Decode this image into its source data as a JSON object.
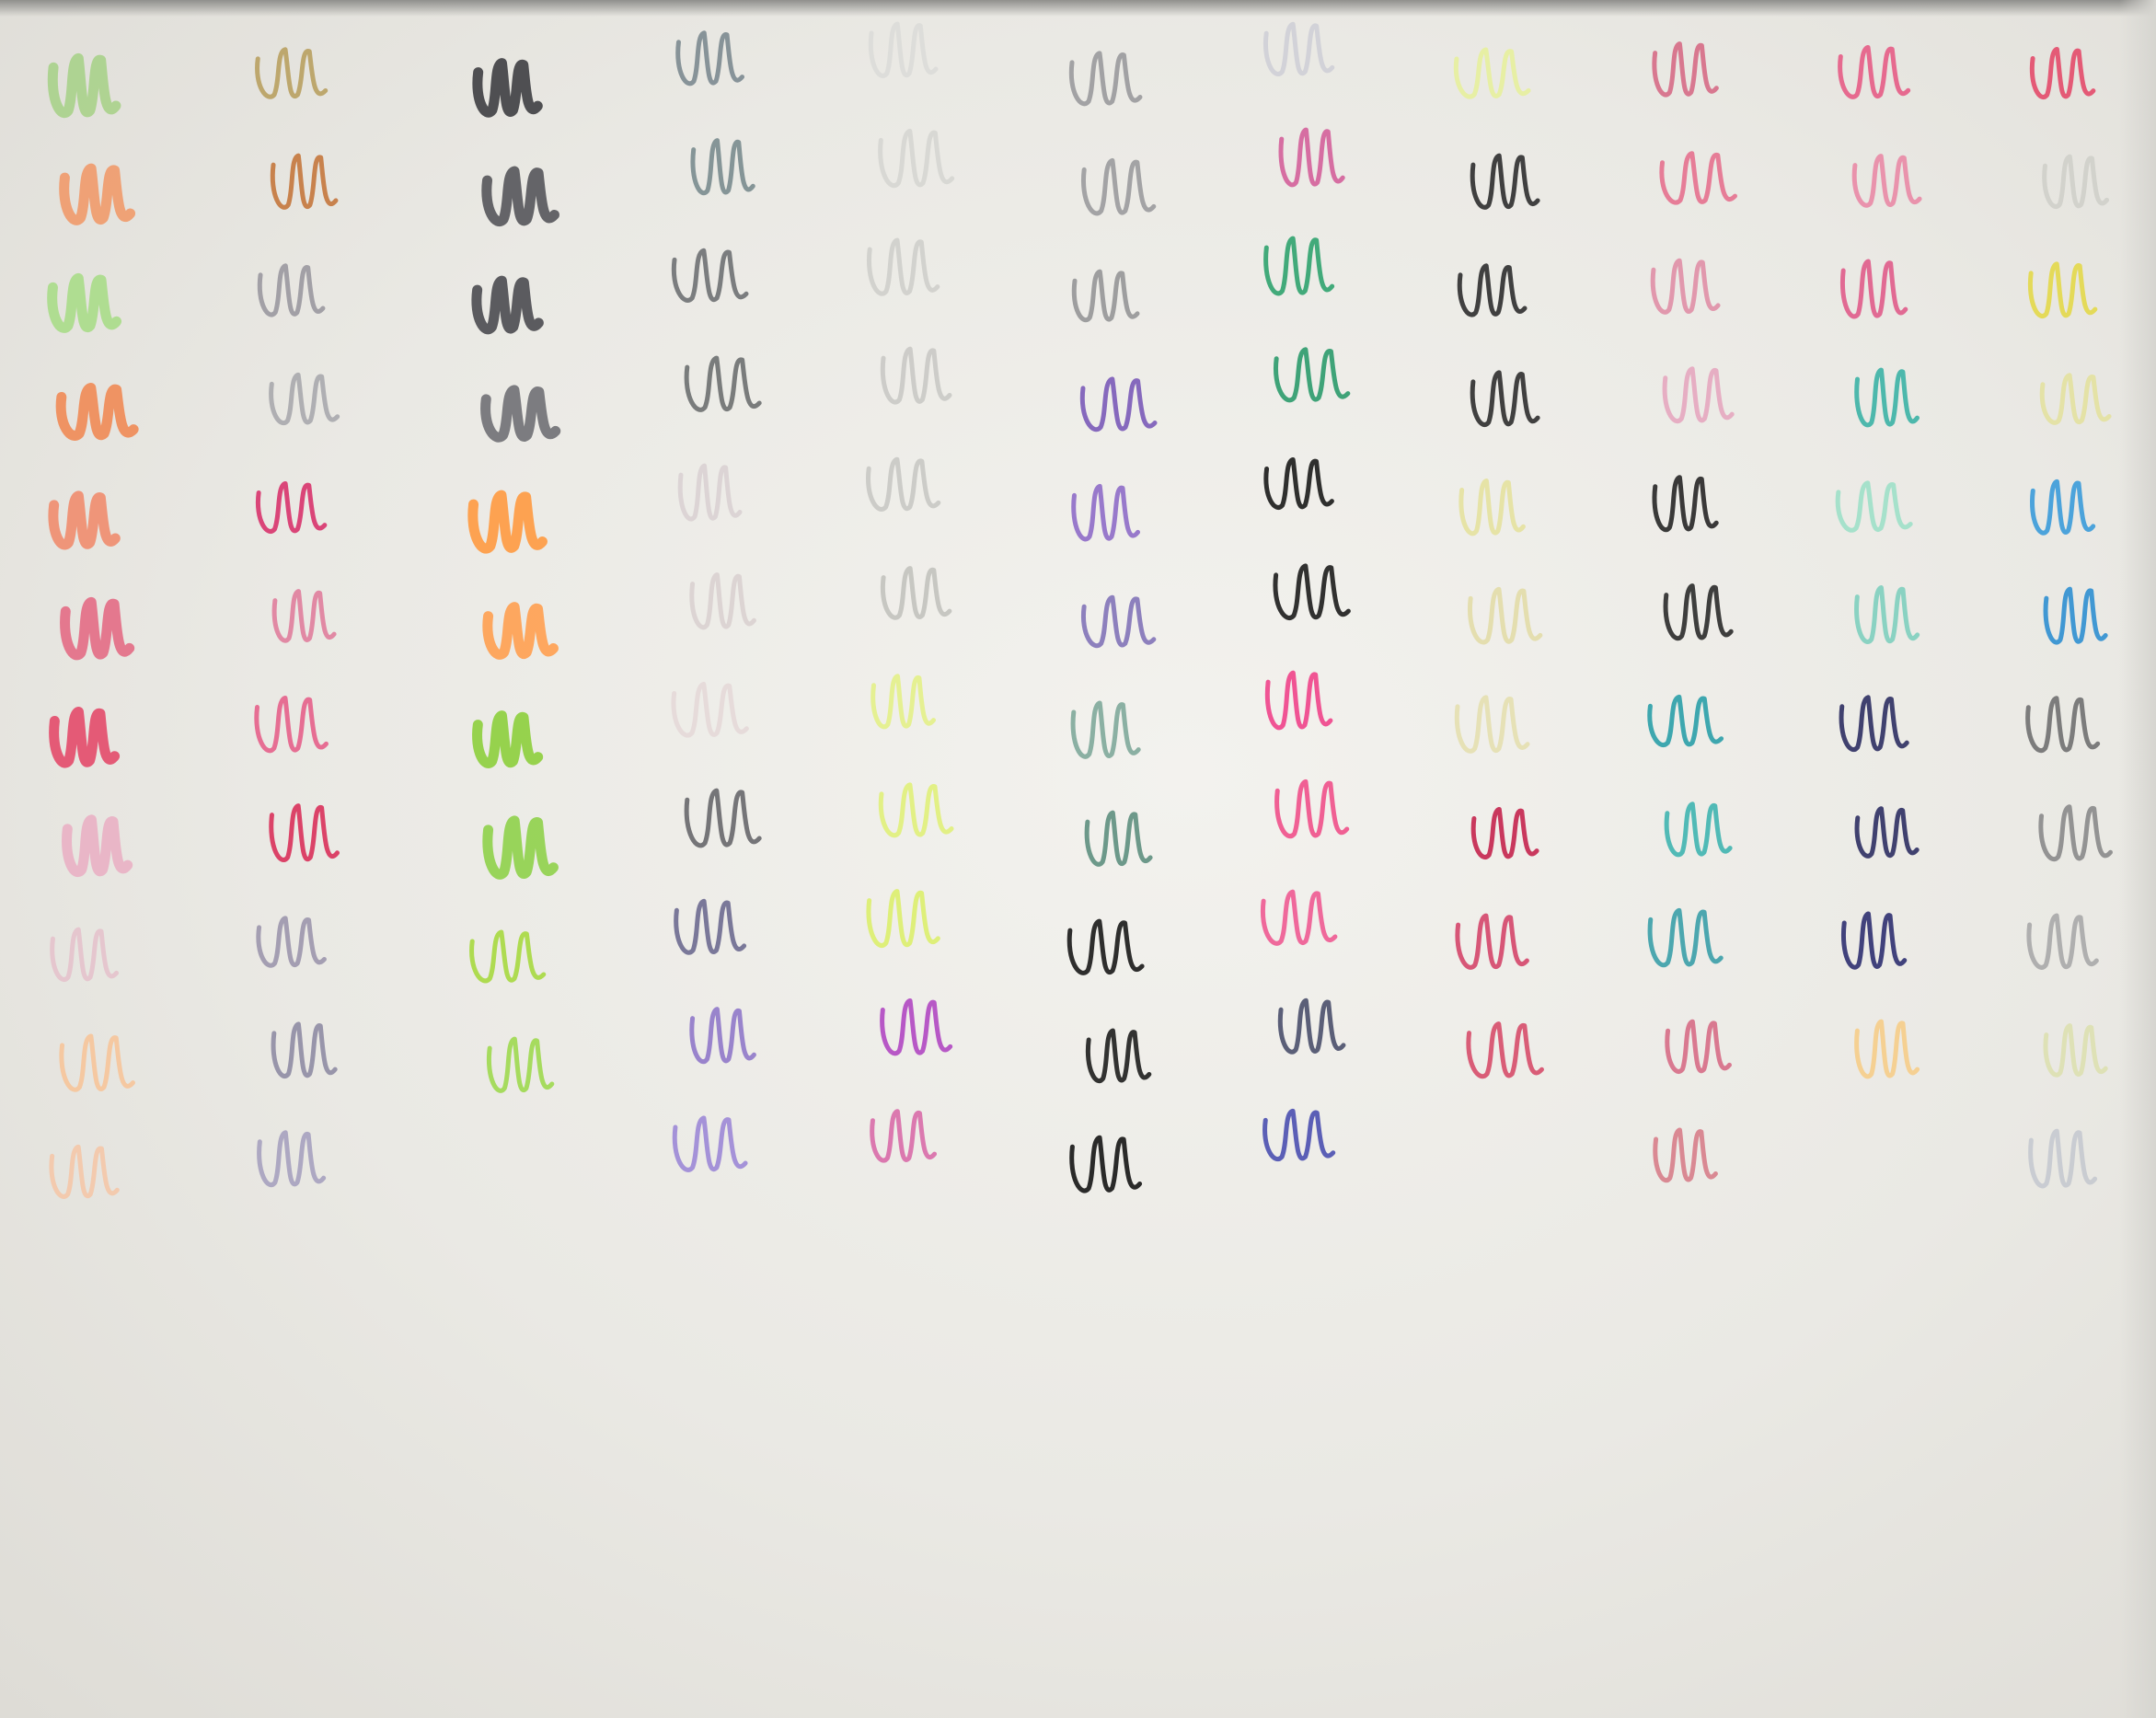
{
  "image": {
    "subject": "pen-swatches",
    "background": "#ecebe6"
  },
  "columns": [
    {
      "colors": [
        "#a9d28a",
        "#ef9a6a",
        "#a8dc88",
        "#f08a55",
        "#ef8c6e",
        "#e36b85",
        "#e34a6a",
        "#e9b0c4",
        "#e4c2cc",
        "#f6c49a",
        "#f4c7a8"
      ]
    },
    {
      "colors": [
        "#b8a060",
        "#c4773d",
        "#9a98a0",
        "#a9a8ad",
        "#d8336c",
        "#e07e9c",
        "#e5608a",
        "#d9315a",
        "#9c96ac",
        "#8f8ca3",
        "#a6a1bf"
      ]
    },
    {
      "colors": [
        "#3e3e42",
        "#55555a",
        "#4b4b50",
        "#707074",
        "#ff9a40",
        "#ffa050",
        "#8dcf3c",
        "#8fd24a",
        "#a7d93f",
        "#9fd94f"
      ]
    },
    {
      "colors": [
        "#7c8a90",
        "#7a8c8e",
        "#6f7173",
        "#6d7070",
        "#d9d2d3",
        "#d9d0d0",
        "#e4d8d8",
        "#67676c",
        "#6d6a90",
        "#8f78c9",
        "#9c88d6"
      ]
    },
    {
      "colors": [
        "#dcdcd8",
        "#d6d6d2",
        "#cfcfcb",
        "#c9c9c5",
        "#c8c8c4",
        "#c2c2be",
        "#e3ef88",
        "#e0ef7a",
        "#dbee6d",
        "#b047c2",
        "#d86ba8"
      ]
    },
    {
      "colors": [
        "#9a9a9c",
        "#9b9b9d",
        "#959697",
        "#7a5ab8",
        "#8e6bc8",
        "#8273b8",
        "#7fa89a",
        "#5e8f7e",
        "#181818",
        "#1d1d1d",
        "#141414"
      ]
    },
    {
      "colors": [
        "#cfcfd6",
        "#d4609a",
        "#2fa36e",
        "#2b9a6c",
        "#1a1a1a",
        "#1c1c1c",
        "#f0428a",
        "#f0508a",
        "#ee5a92",
        "#4a4f6b",
        "#4a4fb0"
      ]
    },
    {
      "colors": [
        "#e7ef9c",
        "#2d2d2d",
        "#2d2d2d",
        "#2d2d2d",
        "#e4e19f",
        "#e2dca8",
        "#e4dfb0",
        "#c4244e",
        "#d4456a",
        "#d64c6a"
      ]
    },
    {
      "colors": [
        "#d66c86",
        "#e6718e",
        "#e08fa6",
        "#e6a7bf",
        "#262626",
        "#2a2a2a",
        "#2a9ea8",
        "#3fb4b0",
        "#3a9fa8",
        "#d66d86",
        "#d77e8a"
      ]
    },
    {
      "colors": [
        "#e55c86",
        "#e98aa6",
        "#e05c8a",
        "#3cb3a5",
        "#9fe0c8",
        "#7fcfbe",
        "#2d2f62",
        "#2d2f62",
        "#2f3070",
        "#f6cd88"
      ]
    },
    {
      "colors": [
        "#e34a6a",
        "#cfcfca",
        "#e3d84a",
        "#e3e1a0",
        "#3b9bd9",
        "#2f8fd0",
        "#707070",
        "#8a8a8a",
        "#a8a8a8",
        "#dde0b0",
        "#c5c9cf"
      ]
    }
  ]
}
